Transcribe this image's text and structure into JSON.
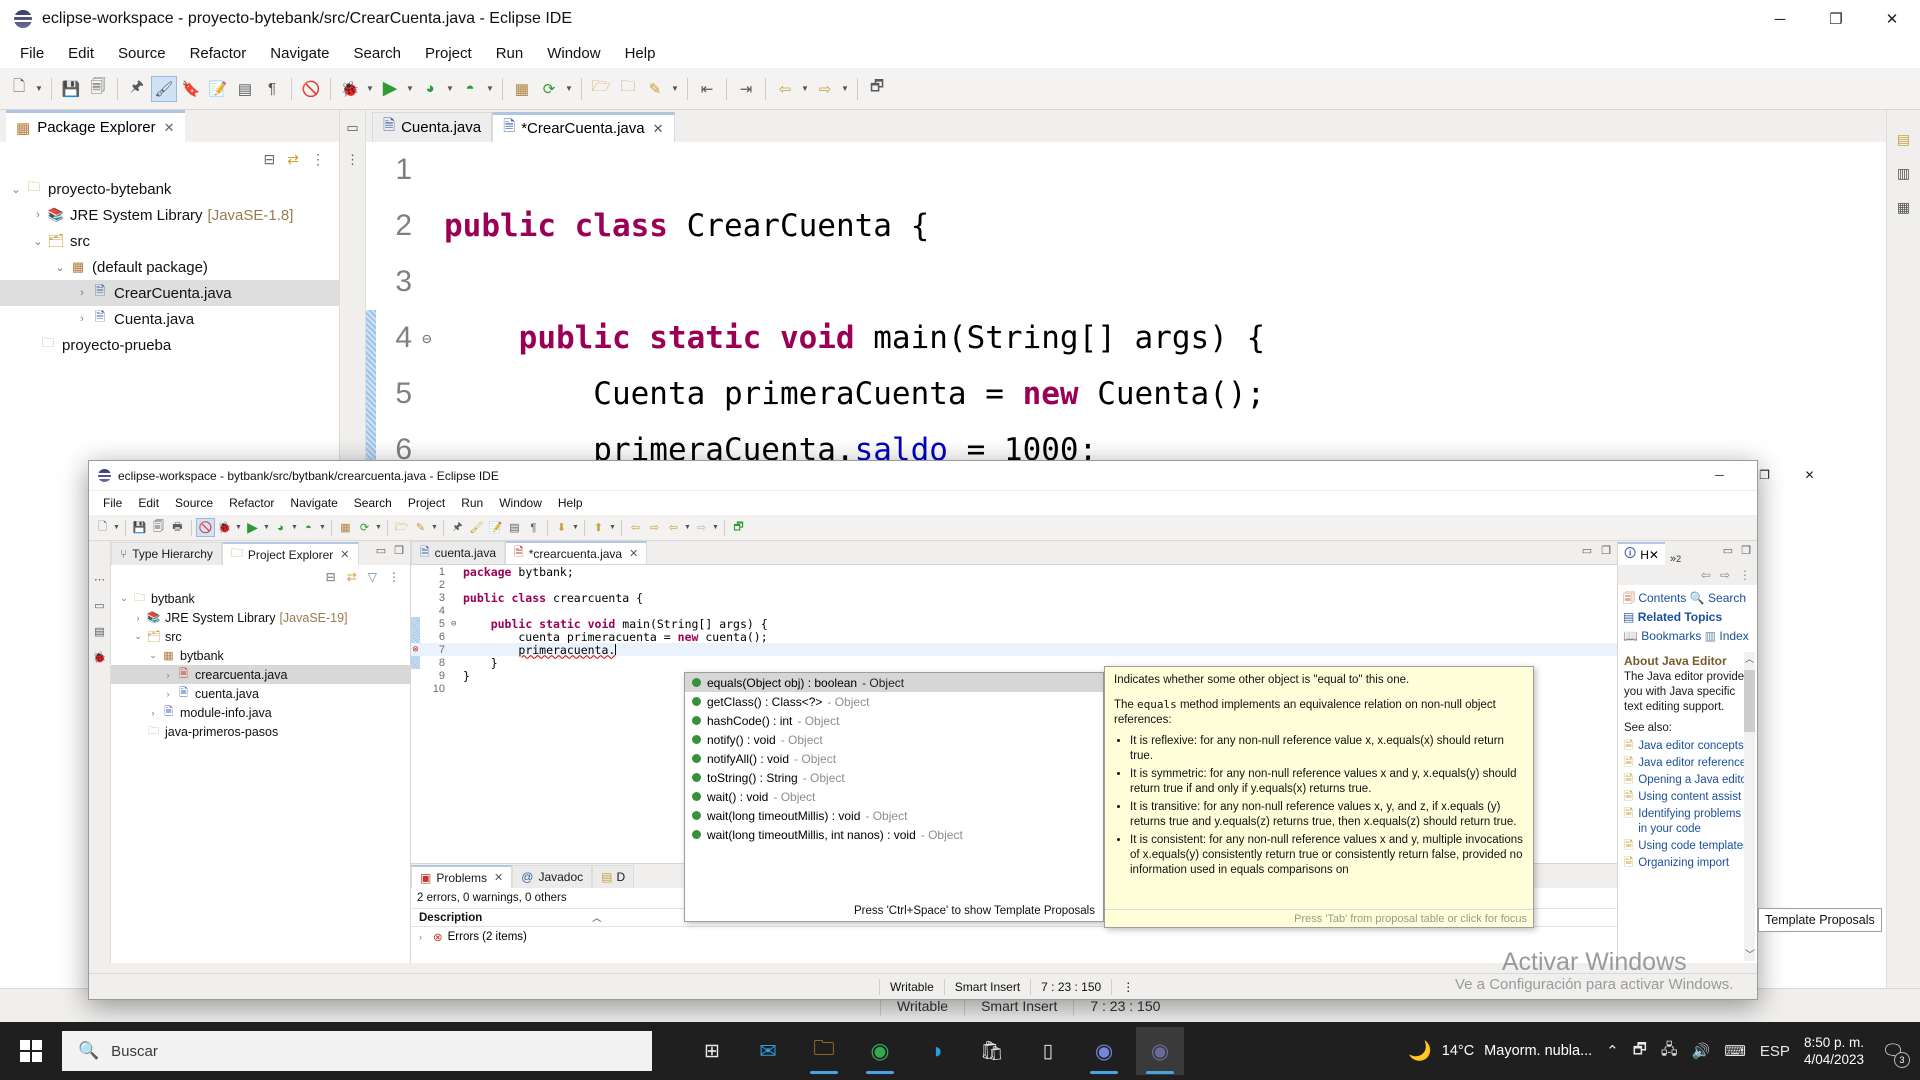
{
  "background_window": {
    "title": "eclipse-workspace - proyecto-bytebank/src/CrearCuenta.java - Eclipse IDE",
    "menu": [
      "File",
      "Edit",
      "Source",
      "Refactor",
      "Navigate",
      "Search",
      "Project",
      "Run",
      "Window",
      "Help"
    ],
    "window_controls": {
      "minimize": "─",
      "maximize": "❐",
      "close": "✕"
    },
    "package_explorer": {
      "tab_label": "Package Explorer",
      "tree": [
        {
          "label": "proyecto-bytebank",
          "icon": "project-icon",
          "twisty": "⌄",
          "depth": 0,
          "selected": false,
          "suffix": ""
        },
        {
          "label": "JRE System Library",
          "icon": "library-icon",
          "twisty": "›",
          "depth": 1,
          "selected": false,
          "suffix": "[JavaSE-1.8]"
        },
        {
          "label": "src",
          "icon": "source-folder-icon",
          "twisty": "⌄",
          "depth": 1,
          "selected": false,
          "suffix": ""
        },
        {
          "label": "(default package)",
          "icon": "package-icon",
          "twisty": "⌄",
          "depth": 2,
          "selected": false,
          "suffix": ""
        },
        {
          "label": "CrearCuenta.java",
          "icon": "java-file-icon",
          "twisty": "›",
          "depth": 3,
          "selected": true,
          "suffix": ""
        },
        {
          "label": "Cuenta.java",
          "icon": "java-file-icon",
          "twisty": "›",
          "depth": 3,
          "selected": false,
          "suffix": ""
        },
        {
          "label": "proyecto-prueba",
          "icon": "closed-project-icon",
          "twisty": "",
          "depth": 0,
          "selected": false,
          "suffix": ""
        }
      ]
    },
    "editor": {
      "tabs": [
        {
          "label": "Cuenta.java",
          "active": false,
          "dirty": false
        },
        {
          "label": "*CrearCuenta.java",
          "active": true,
          "dirty": true
        }
      ],
      "lines": [
        {
          "no": "1",
          "fold": "",
          "segments": []
        },
        {
          "no": "2",
          "fold": "",
          "segments": [
            {
              "t": "public ",
              "c": "kw"
            },
            {
              "t": "class ",
              "c": "kw"
            },
            {
              "t": "CrearCuenta {",
              "c": ""
            }
          ]
        },
        {
          "no": "3",
          "fold": "",
          "segments": []
        },
        {
          "no": "4",
          "fold": "⊖",
          "segments": [
            {
              "t": "    ",
              "c": ""
            },
            {
              "t": "public static void ",
              "c": "kw"
            },
            {
              "t": "main(String[] args) {",
              "c": ""
            }
          ]
        },
        {
          "no": "5",
          "fold": "",
          "segments": [
            {
              "t": "        Cuenta primeraCuenta = ",
              "c": ""
            },
            {
              "t": "new ",
              "c": "kw"
            },
            {
              "t": "Cuenta();",
              "c": ""
            }
          ]
        },
        {
          "no": "6",
          "fold": "",
          "segments": [
            {
              "t": "        primeraCuenta.",
              "c": ""
            },
            {
              "t": "saldo",
              "c": "fld"
            },
            {
              "t": " = 1000;",
              "c": ""
            }
          ]
        }
      ]
    },
    "status_bar": {
      "writable": "Writable",
      "insert_mode": "Smart Insert",
      "position": "7 : 23 : 150"
    }
  },
  "foreground_window": {
    "title": "eclipse-workspace - bytbank/src/bytbank/crearcuenta.java - Eclipse IDE",
    "menu": [
      "File",
      "Edit",
      "Source",
      "Refactor",
      "Navigate",
      "Search",
      "Project",
      "Run",
      "Window",
      "Help"
    ],
    "window_controls": {
      "minimize": "─",
      "maximize": "❐",
      "close": "✕"
    },
    "views": {
      "tabs": [
        {
          "label": "Type Hierarchy",
          "active": false,
          "icon": "type-hierarchy-icon"
        },
        {
          "label": "Project Explorer",
          "active": true,
          "icon": "project-explorer-icon"
        }
      ],
      "tree": [
        {
          "label": "bytbank",
          "icon": "project-error-icon",
          "twisty": "⌄",
          "depth": 0,
          "selected": false,
          "suffix": ""
        },
        {
          "label": "JRE System Library",
          "icon": "library-icon",
          "twisty": "›",
          "depth": 1,
          "selected": false,
          "suffix": "[JavaSE-19]"
        },
        {
          "label": "src",
          "icon": "source-folder-error-icon",
          "twisty": "⌄",
          "depth": 1,
          "selected": false,
          "suffix": ""
        },
        {
          "label": "bytbank",
          "icon": "package-error-icon",
          "twisty": "⌄",
          "depth": 2,
          "selected": false,
          "suffix": ""
        },
        {
          "label": "crearcuenta.java",
          "icon": "java-file-error-icon",
          "twisty": "›",
          "depth": 3,
          "selected": true,
          "suffix": ""
        },
        {
          "label": "cuenta.java",
          "icon": "java-file-icon",
          "twisty": "›",
          "depth": 3,
          "selected": false,
          "suffix": ""
        },
        {
          "label": "module-info.java",
          "icon": "java-file-icon",
          "twisty": "›",
          "depth": 2,
          "selected": false,
          "suffix": ""
        },
        {
          "label": "java-primeros-pasos",
          "icon": "closed-project-icon",
          "twisty": "",
          "depth": 1,
          "selected": false,
          "suffix": ""
        }
      ]
    },
    "editor": {
      "tabs": [
        {
          "label": "cuenta.java",
          "active": false
        },
        {
          "label": "*crearcuenta.java",
          "active": true
        }
      ],
      "lines": [
        {
          "no": "1",
          "fold": "",
          "marker": "",
          "current": false,
          "segments": [
            {
              "t": "package ",
              "c": "kw"
            },
            {
              "t": "bytbank;",
              "c": ""
            }
          ]
        },
        {
          "no": "2",
          "fold": "",
          "marker": "",
          "current": false,
          "segments": []
        },
        {
          "no": "3",
          "fold": "",
          "marker": "",
          "current": false,
          "segments": [
            {
              "t": "public class ",
              "c": "kw"
            },
            {
              "t": "crearcuenta {",
              "c": ""
            }
          ]
        },
        {
          "no": "4",
          "fold": "",
          "marker": "",
          "current": false,
          "segments": []
        },
        {
          "no": "5",
          "fold": "⊖",
          "marker": "hatch",
          "current": false,
          "segments": [
            {
              "t": "    ",
              "c": ""
            },
            {
              "t": "public static void ",
              "c": "kw"
            },
            {
              "t": "main(String[] args) {",
              "c": ""
            }
          ]
        },
        {
          "no": "6",
          "fold": "",
          "marker": "hatch",
          "current": false,
          "segments": [
            {
              "t": "        cuenta primeracuenta = ",
              "c": ""
            },
            {
              "t": "new ",
              "c": "kw"
            },
            {
              "t": "cuenta();",
              "c": ""
            }
          ]
        },
        {
          "no": "7",
          "fold": "",
          "marker": "error",
          "current": true,
          "segments": [
            {
              "t": "        ",
              "c": ""
            },
            {
              "t": "primeracuenta.",
              "c": "sq"
            }
          ]
        },
        {
          "no": "8",
          "fold": "",
          "marker": "hatch",
          "current": false,
          "segments": [
            {
              "t": "    }",
              "c": ""
            }
          ]
        },
        {
          "no": "9",
          "fold": "",
          "marker": "",
          "current": false,
          "segments": [
            {
              "t": "}",
              "c": ""
            }
          ]
        },
        {
          "no": "10",
          "fold": "",
          "marker": "",
          "current": false,
          "segments": []
        }
      ]
    },
    "bottom_panel": {
      "tabs": [
        {
          "label": "Problems",
          "active": true,
          "icon": "problems-icon"
        },
        {
          "label": "Javadoc",
          "active": false,
          "icon": "at-icon"
        },
        {
          "label": "D",
          "active": false,
          "icon": "declaration-icon"
        }
      ],
      "summary": "2 errors, 0 warnings, 0 others",
      "column_header": "Description",
      "rows": [
        {
          "twisty": "›",
          "icon": "error-icon",
          "label": "Errors (2 items)"
        }
      ]
    },
    "help_view": {
      "tab_label": "H",
      "overflow_label": "»",
      "overflow_count": "2",
      "links": [
        "Contents",
        "Search",
        "Related Topics",
        "Bookmarks",
        "Index"
      ],
      "heading": "About Java Editor",
      "paragraph": "The Java editor provides you with Java specific text editing support.",
      "see_also_label": "See also:",
      "topics": [
        "Java editor concepts",
        "Java editor reference",
        "Opening a Java editor",
        "Using content assist",
        "Identifying problems in your code",
        "Using code templates",
        "Organizing import"
      ]
    },
    "status_bar": {
      "writable": "Writable",
      "insert_mode": "Smart Insert",
      "position": "7 : 23 : 150"
    }
  },
  "content_assist": {
    "proposals": [
      {
        "label": "equals(Object obj) : boolean",
        "owner": "- Object",
        "selected": true
      },
      {
        "label": "getClass() : Class<?>",
        "owner": "- Object",
        "selected": false
      },
      {
        "label": "hashCode() : int",
        "owner": "- Object",
        "selected": false
      },
      {
        "label": "notify() : void",
        "owner": "- Object",
        "selected": false
      },
      {
        "label": "notifyAll() : void",
        "owner": "- Object",
        "selected": false
      },
      {
        "label": "toString() : String",
        "owner": "- Object",
        "selected": false
      },
      {
        "label": "wait() : void",
        "owner": "- Object",
        "selected": false
      },
      {
        "label": "wait(long timeoutMillis) : void",
        "owner": "- Object",
        "selected": false
      },
      {
        "label": "wait(long timeoutMillis, int nanos) : void",
        "owner": "- Object",
        "selected": false
      }
    ],
    "footer_hint": "Press 'Ctrl+Space' to show Template Proposals",
    "javadoc": {
      "intro": "Indicates whether some other object is \"equal to\" this one.",
      "body_prefix": "The ",
      "body_mono": "equals",
      "body_suffix": " method implements an equivalence relation on non-null object references:",
      "bullets": [
        "It is reflexive: for any non-null reference value x, x.equals(x) should return true.",
        "It is symmetric: for any non-null reference values x and y, x.equals(y) should return true if and only if y.equals(x) returns true.",
        "It is transitive: for any non-null reference values x, y, and z, if x.equals (y) returns true and y.equals(z) returns true, then x.equals(z) should return true.",
        "It is consistent: for any non-null reference values x and y, multiple invocations of x.equals(y) consistently return true or consistently return false, provided no information used in equals comparisons on"
      ],
      "footer_hint": "Press 'Tab' from proposal table or click for focus"
    },
    "template_tooltip": "Template Proposals"
  },
  "watermark": {
    "line1": "Activar Windows",
    "line2": "Ve a Configuración para activar Windows."
  },
  "taskbar": {
    "start_icon": "windows-start-icon",
    "search_placeholder": "Buscar",
    "apps": [
      {
        "name": "task-view-icon",
        "glyph": "⌸",
        "running": false
      },
      {
        "name": "mail-icon",
        "glyph": "✉",
        "running": false
      },
      {
        "name": "file-explorer-icon",
        "glyph": "📁",
        "running": true
      },
      {
        "name": "chrome-icon",
        "glyph": "◉",
        "running": true
      },
      {
        "name": "edge-icon",
        "glyph": "●",
        "running": false
      },
      {
        "name": "microsoft-store-icon",
        "glyph": "🛒",
        "running": false
      },
      {
        "name": "app-icon",
        "glyph": "▯",
        "running": false
      },
      {
        "name": "discord-icon",
        "glyph": "●",
        "running": true
      },
      {
        "name": "eclipse-icon",
        "glyph": "●",
        "running": true
      }
    ],
    "weather": {
      "temperature": "14°C",
      "condition": "Mayorm. nubla...",
      "icon": "night-cloud-icon"
    },
    "tray": [
      "⌃",
      "▢",
      "⌸",
      "🔊",
      "⌨"
    ],
    "language": "ESP",
    "clock_time": "8:50 p. m.",
    "clock_date": "4/04/2023",
    "notification_count": "3"
  }
}
